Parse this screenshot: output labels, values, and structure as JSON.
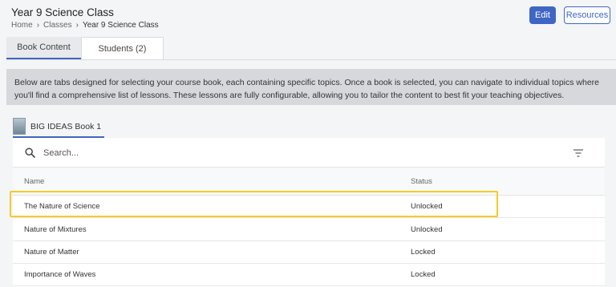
{
  "header": {
    "title": "Year 9 Science Class",
    "breadcrumb": [
      "Home",
      "Classes",
      "Year 9 Science Class"
    ]
  },
  "actions": {
    "edit_label": "Edit",
    "resources_label": "Resources"
  },
  "tabs": [
    {
      "label": "Book Content",
      "active": true
    },
    {
      "label": "Students (2)",
      "active": false
    }
  ],
  "info_text": "Below are tabs designed for selecting your course book, each containing specific topics. Once a book is selected, you can navigate to individual topics where you'll find a comprehensive list of lessons. These lessons are fully configurable, allowing you to tailor the content to best fit your teaching objectives.",
  "book_tab": {
    "label": "BIG IDEAS Book 1"
  },
  "search": {
    "placeholder": "Search...",
    "value": ""
  },
  "table": {
    "columns": [
      "Name",
      "Status"
    ],
    "rows": [
      {
        "name": "The Nature of Science",
        "status": "Unlocked"
      },
      {
        "name": "Nature of Mixtures",
        "status": "Unlocked"
      },
      {
        "name": "Nature of Matter",
        "status": "Locked"
      },
      {
        "name": "Importance of Waves",
        "status": "Locked"
      }
    ]
  },
  "colors": {
    "accent": "#3f66c4",
    "highlight": "#f5cb2a"
  }
}
